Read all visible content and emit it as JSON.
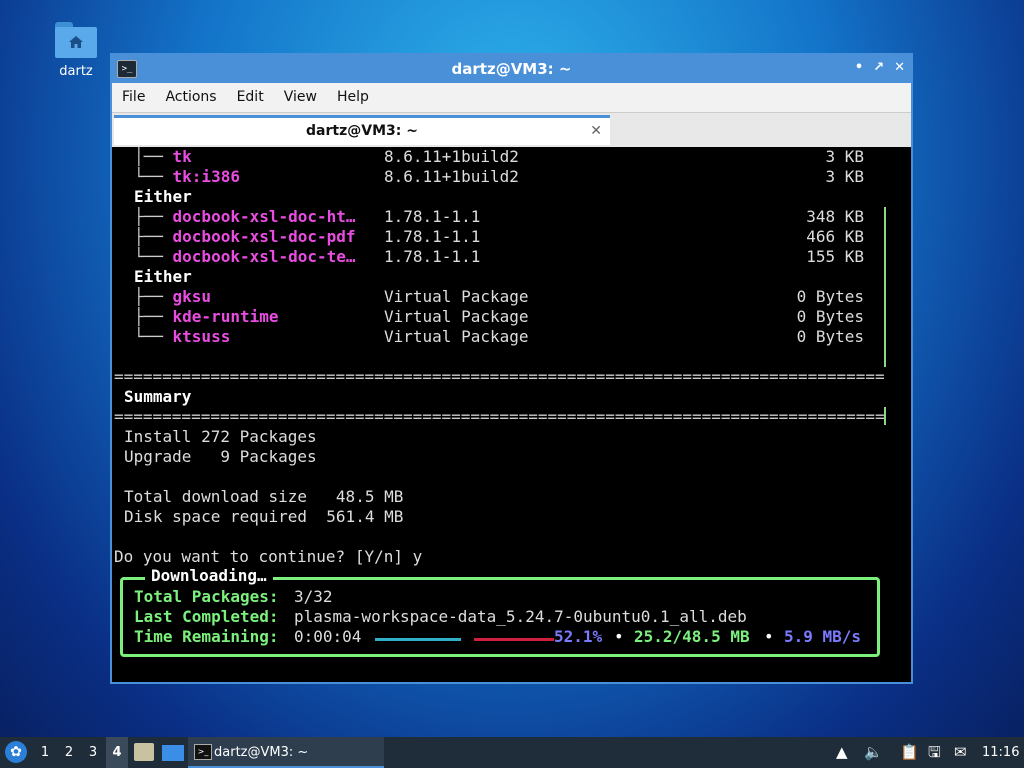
{
  "desktop": {
    "icon_label": "dartz"
  },
  "window": {
    "title": "dartz@VM3: ~",
    "controls": {
      "minimize": "•",
      "maximize": "↗",
      "close": "✕"
    },
    "menu": [
      "File",
      "Actions",
      "Edit",
      "View",
      "Help"
    ],
    "tab_title": "dartz@VM3: ~",
    "tab_close": "✕"
  },
  "terminal": {
    "packages_top": [
      {
        "tree": "│── ",
        "name": "tk",
        "version": "8.6.11+1build2",
        "size": "3 KB"
      },
      {
        "tree": "└── ",
        "name": "tk:i386",
        "version": "8.6.11+1build2",
        "size": "3 KB"
      }
    ],
    "either1": "Either",
    "packages_either1": [
      {
        "tree": "├── ",
        "name": "docbook-xsl-doc-ht…",
        "version": "1.78.1-1.1",
        "size": "348 KB"
      },
      {
        "tree": "├── ",
        "name": "docbook-xsl-doc-pdf",
        "version": "1.78.1-1.1",
        "size": "466 KB"
      },
      {
        "tree": "└── ",
        "name": "docbook-xsl-doc-te…",
        "version": "1.78.1-1.1",
        "size": "155 KB"
      }
    ],
    "either2": "Either",
    "packages_either2": [
      {
        "tree": "├── ",
        "name": "gksu",
        "version": "Virtual Package",
        "size": "0 Bytes"
      },
      {
        "tree": "├── ",
        "name": "kde-runtime",
        "version": "Virtual Package",
        "size": "0 Bytes"
      },
      {
        "tree": "└── ",
        "name": "ktsuss",
        "version": "Virtual Package",
        "size": "0 Bytes"
      }
    ],
    "separator": "=============================================================================================",
    "summary_title": "Summary",
    "install": "Install 272 Packages",
    "upgrade": "Upgrade   9 Packages",
    "download_size": "Total download size   48.5 MB",
    "disk_space": "Disk space required  561.4 MB",
    "prompt": "Do you want to continue? [Y/n] y",
    "downloading": {
      "title": "Downloading…",
      "total_label": "Total Packages:",
      "total_value": "3/32",
      "last_label": "Last Completed:",
      "last_value": "plasma-workspace-data_5.24.7-0ubuntu0.1_all.deb",
      "time_label": "Time Remaining:",
      "time_value": "0:00:04",
      "percent": "52.1%",
      "bullet": "•",
      "amount": "25.2/48.5 MB",
      "speed": "5.9 MB/s"
    }
  },
  "taskbar": {
    "workspaces": [
      "1",
      "2",
      "3",
      "4"
    ],
    "task_label": "dartz@VM3: ~",
    "clock": "11:16"
  }
}
